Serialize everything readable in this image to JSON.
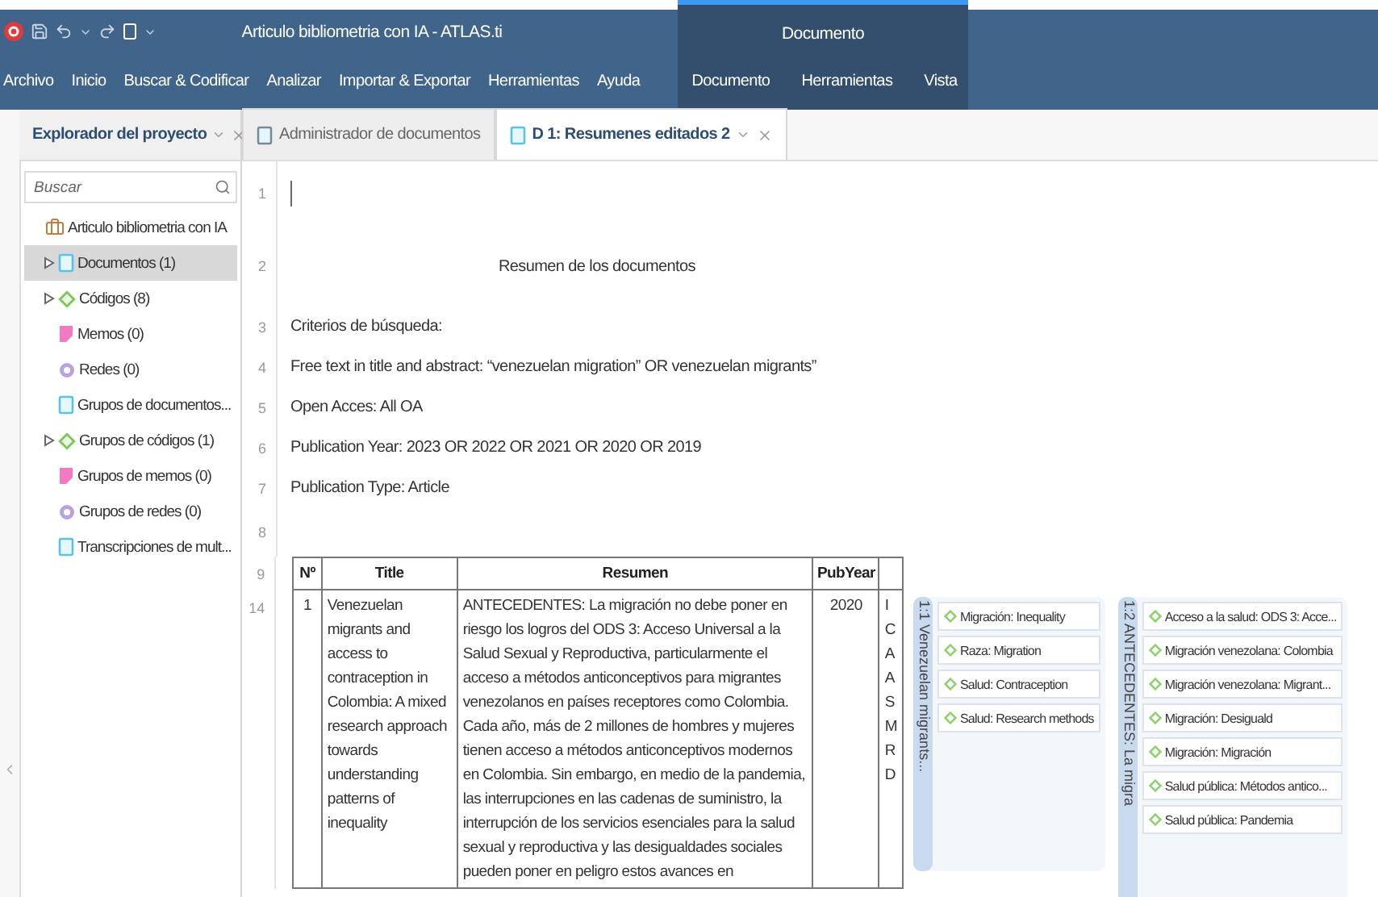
{
  "window": {
    "title": "Articulo bibliometria con IA - ATLAS.ti"
  },
  "ribbon": {
    "menu": [
      "Archivo",
      "Inicio",
      "Buscar & Codificar",
      "Analizar",
      "Importar & Exportar",
      "Herramientas",
      "Ayuda"
    ],
    "context": {
      "title": "Documento",
      "menu": [
        "Documento",
        "Herramientas",
        "Vista"
      ]
    }
  },
  "explorer": {
    "title": "Explorador del proyecto",
    "search": {
      "placeholder": "Buscar"
    },
    "items": [
      {
        "label": "Articulo bibliometria con IA",
        "kind": "project",
        "expandable": false,
        "selected": false,
        "children": [
          {
            "label": "Documentos (1)",
            "kind": "documents",
            "expandable": true,
            "selected": true
          },
          {
            "label": "Códigos (8)",
            "kind": "codes",
            "expandable": true,
            "selected": false
          },
          {
            "label": "Memos (0)",
            "kind": "memos",
            "expandable": false,
            "selected": false
          },
          {
            "label": "Redes (0)",
            "kind": "networks",
            "expandable": false,
            "selected": false
          },
          {
            "label": "Grupos de documentos...",
            "kind": "document-groups",
            "expandable": false,
            "selected": false
          },
          {
            "label": "Grupos de códigos (1)",
            "kind": "code-groups",
            "expandable": true,
            "selected": false
          },
          {
            "label": "Grupos de memos (0)",
            "kind": "memo-groups",
            "expandable": false,
            "selected": false
          },
          {
            "label": "Grupos de redes (0)",
            "kind": "network-groups",
            "expandable": false,
            "selected": false
          },
          {
            "label": "Transcripciones de mult...",
            "kind": "transcripts",
            "expandable": false,
            "selected": false
          }
        ]
      }
    ]
  },
  "tabs": [
    {
      "label": "Administrador de documentos",
      "kind": "manager",
      "selected": false
    },
    {
      "label": "D 1: Resumenes editados 2",
      "kind": "document",
      "selected": true
    }
  ],
  "document": {
    "lines": [
      {
        "number": "1",
        "kind": "cursor"
      },
      {
        "number": "2",
        "kind": "heading",
        "text": "Resumen de los documentos"
      },
      {
        "number": "3",
        "kind": "text",
        "text": "Criterios de búsqueda:"
      },
      {
        "number": "4",
        "kind": "text",
        "text": "Free text in title and abstract: “venezuelan migration” OR venezuelan migrants”"
      },
      {
        "number": "5",
        "kind": "text",
        "text": "Open Acces: All OA"
      },
      {
        "number": "6",
        "kind": "text",
        "text": "Publication Year: 2023 OR 2022 OR 2021 OR 2020 OR 2019"
      },
      {
        "number": "7",
        "kind": "text",
        "text": "Publication Type: Article"
      },
      {
        "number": "8",
        "kind": "blank"
      }
    ],
    "table": {
      "header_line": "9",
      "columns": [
        "Nº",
        "Title",
        "Resumen",
        "PubYear"
      ],
      "rows": [
        {
          "line": "14",
          "cells": [
            "1",
            "Venezuelan migrants and access to contraception in Colombia: A mixed research approach towards understanding patterns of inequality",
            "ANTECEDENTES: La migración no debe poner en riesgo los logros del ODS 3: Acceso Universal a la Salud Sexual y Reproductiva, particularmente el acceso a métodos anticonceptivos para migrantes venezolanos en países receptores como Colombia. Cada año, más de 2 millones de hombres y mujeres tienen acceso a métodos anticonceptivos modernos en Colombia. Sin embargo, en medio de la pandemia, las interrupciones en las cadenas de suministro, la interrupción de los servicios esenciales para la salud sexual y reproductiva y las desigualdades sociales pueden poner en peligro estos avances en",
            "2020"
          ],
          "column_5": [
            "I",
            "C",
            "A",
            "A",
            "S",
            "M",
            "R",
            "D"
          ]
        }
      ]
    }
  },
  "margin": [
    {
      "label": "1:1 Venezuelan migrants...",
      "codes": [
        "Migración: Inequality",
        "Raza: Migration",
        "Salud: Contraception",
        "Salud: Research methods"
      ]
    },
    {
      "label": "1:2 ANTECEDENTES: La migra",
      "codes": [
        "Acceso a la salud: ODS 3: Acce...",
        "Migración venezolana: Colombia",
        "Migración venezolana: Migrant...",
        "Migración: Desiguald",
        "Migración: Migración",
        "Salud pública: Métodos antico...",
        "Salud pública: Pandemia"
      ]
    }
  ]
}
